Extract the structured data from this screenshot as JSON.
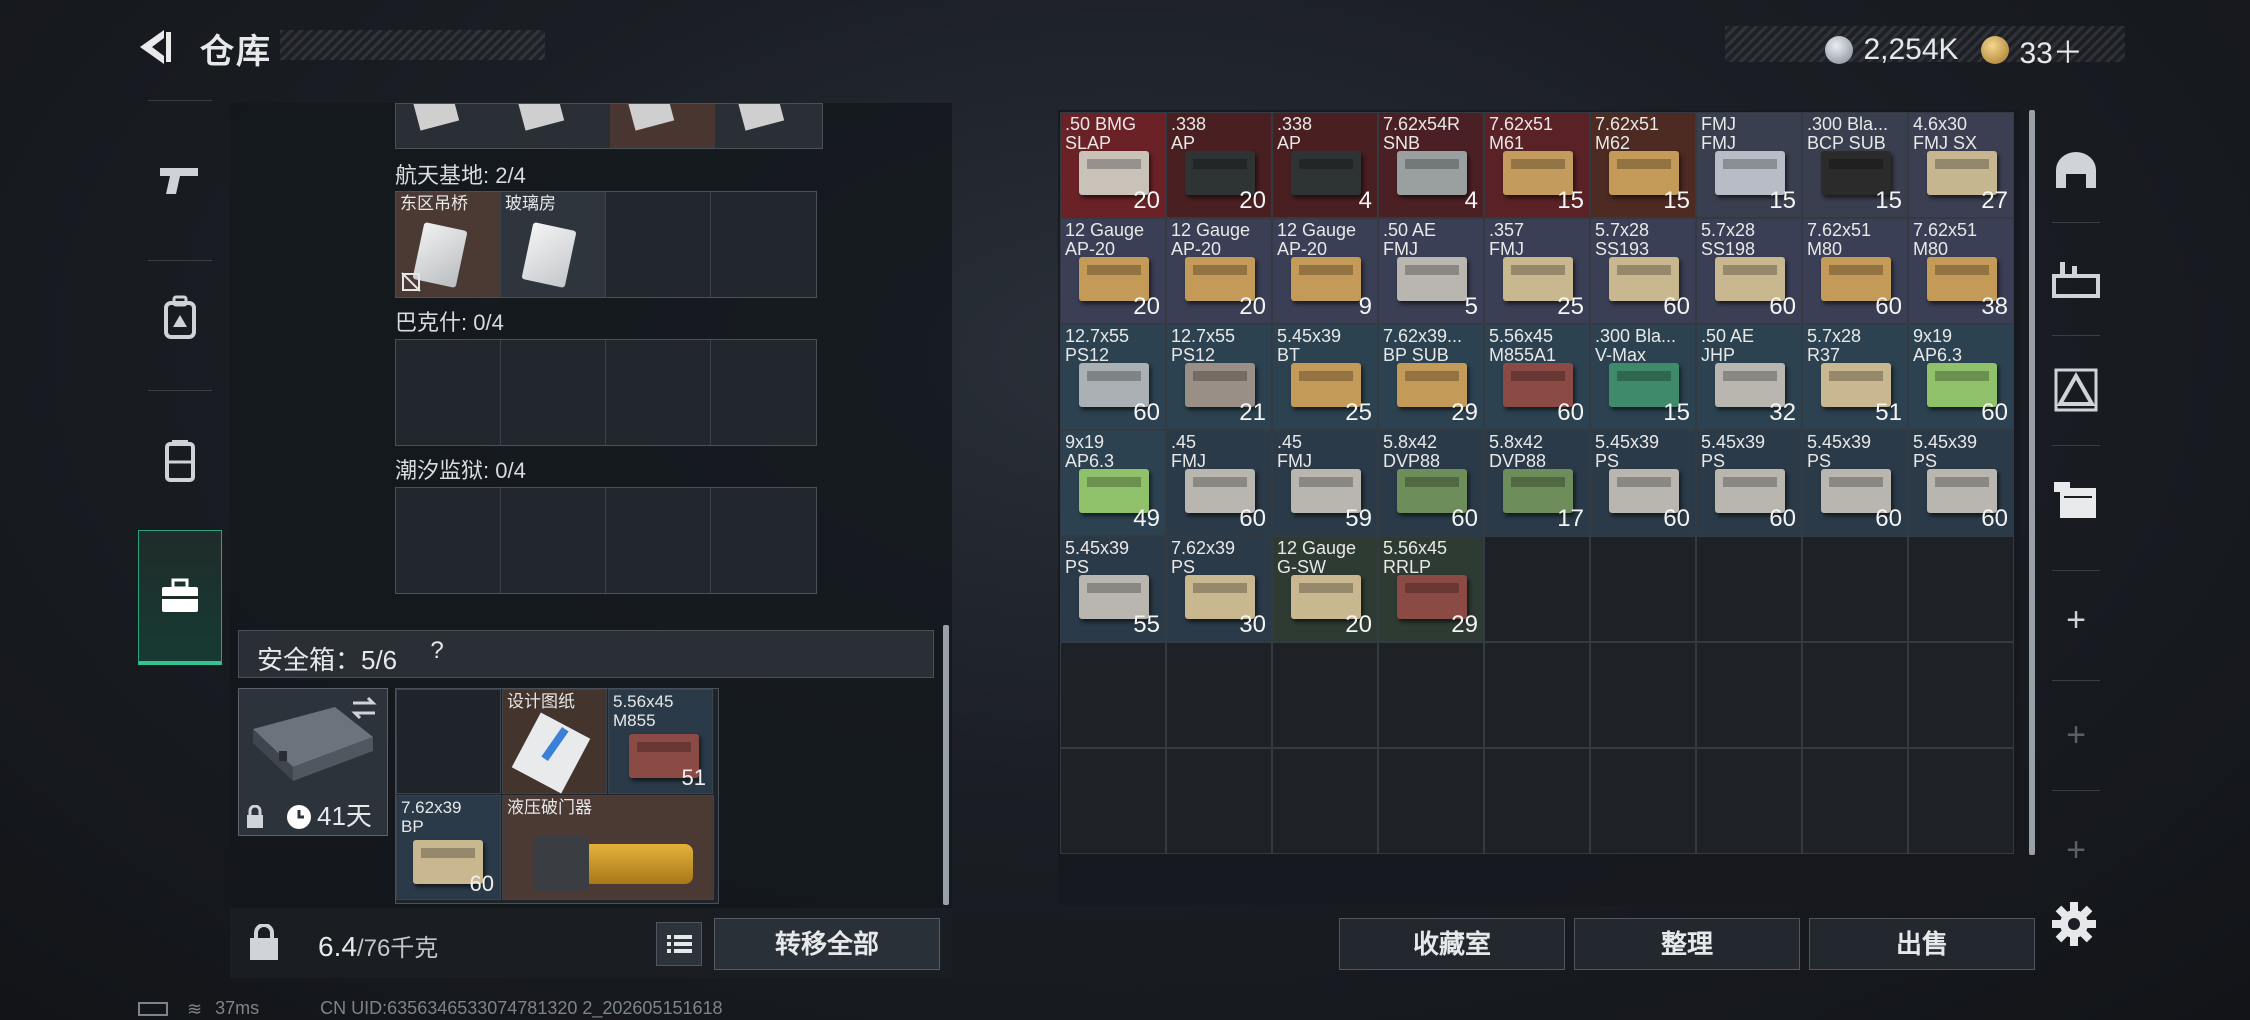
{
  "header": {
    "title": "仓库"
  },
  "currency": [
    {
      "icon": "silver-coin-icon",
      "value": "2,254K",
      "color": "#b9c0c8"
    },
    {
      "icon": "gold-coin-icon",
      "value": "33＋",
      "color": "#c9a043"
    }
  ],
  "left_nav": [
    {
      "icon": "pistol-icon"
    },
    {
      "icon": "backpack-icon"
    },
    {
      "icon": "vest-icon"
    },
    {
      "icon": "briefcase-icon",
      "active": true
    }
  ],
  "sections": [
    {
      "label": "航天基地: 2/4",
      "slots": [
        {
          "name": "东区吊桥",
          "locked": true
        },
        {
          "name": "玻璃房"
        },
        {
          "name": ""
        },
        {
          "name": ""
        }
      ]
    },
    {
      "label": "巴克什: 0/4"
    },
    {
      "label": "潮汐监狱: 0/4"
    }
  ],
  "safe_box": {
    "label": "安全箱：5/6",
    "help": "?",
    "timer": "41天",
    "items": [
      {
        "name": "设计图纸",
        "count": ""
      },
      {
        "name": "5.56x45\nM855",
        "count": "51"
      },
      {
        "name": "7.62x39\nBP",
        "count": "60"
      },
      {
        "name": "液压破门器",
        "count": ""
      }
    ]
  },
  "weight": {
    "current": "6.4",
    "max": "/76千克"
  },
  "buttons": {
    "transfer_all": "转移全部",
    "collection": "收藏室",
    "organize": "整理",
    "sell": "出售"
  },
  "stash_items": [
    {
      "name": ".50 BMG\nSLAP",
      "count": "20",
      "bg": "#6b2226",
      "box": "#c8c2b8"
    },
    {
      "name": ".338\nAP",
      "count": "20",
      "bg": "#4a1f22",
      "box": "#2e3334"
    },
    {
      "name": ".338\nAP",
      "count": "4",
      "bg": "#4a1f22",
      "box": "#2e3334"
    },
    {
      "name": "7.62x54R\nSNB",
      "count": "4",
      "bg": "#4b2024",
      "box": "#9aa0a0"
    },
    {
      "name": "7.62x51\nM61",
      "count": "15",
      "bg": "#5a2226",
      "box": "#c39b5c"
    },
    {
      "name": "7.62x51\nM62",
      "count": "15",
      "bg": "#4d2a22",
      "box": "#c49a58"
    },
    {
      "name": "FMJ\nFMJ",
      "count": "15",
      "bg": "#3a3f4f",
      "box": "#b7bcc6"
    },
    {
      "name": ".300 Bla...\nBCP SUB",
      "count": "15",
      "bg": "#3a3f4f",
      "box": "#2b2b2b"
    },
    {
      "name": "4.6x30\nFMJ SX",
      "count": "27",
      "bg": "#3c3f52",
      "box": "#c5b690"
    },
    {
      "name": "12 Gauge\nAP-20",
      "count": "20",
      "bg": "#3a3f55",
      "box": "#c49a58"
    },
    {
      "name": "12 Gauge\nAP-20",
      "count": "20",
      "bg": "#3a3f55",
      "box": "#c49a58"
    },
    {
      "name": "12 Gauge\nAP-20",
      "count": "9",
      "bg": "#3a3f55",
      "box": "#c49a58"
    },
    {
      "name": ".50 AE\nFMJ",
      "count": "5",
      "bg": "#3a3f55",
      "box": "#b8b6ae"
    },
    {
      "name": ".357\nFMJ",
      "count": "25",
      "bg": "#3a3f55",
      "box": "#c9b78f"
    },
    {
      "name": "5.7x28\nSS193",
      "count": "60",
      "bg": "#3a3f55",
      "box": "#c9b78f"
    },
    {
      "name": "5.7x28\nSS198",
      "count": "60",
      "bg": "#3a3f55",
      "box": "#c9b78f"
    },
    {
      "name": "7.62x51\nM80",
      "count": "60",
      "bg": "#3a3f55",
      "box": "#c49a58"
    },
    {
      "name": "7.62x51\nM80",
      "count": "38",
      "bg": "#3a3f55",
      "box": "#c49a58"
    },
    {
      "name": "12.7x55\nPS12",
      "count": "60",
      "bg": "#2c4250",
      "box": "#aab0b4"
    },
    {
      "name": "12.7x55\nPS12",
      "count": "21",
      "bg": "#2c4250",
      "box": "#9a8f86"
    },
    {
      "name": "5.45x39\nBT",
      "count": "25",
      "bg": "#2c4250",
      "box": "#c49a58"
    },
    {
      "name": "7.62x39...\nBP SUB",
      "count": "29",
      "bg": "#2c4250",
      "box": "#c49a58"
    },
    {
      "name": "5.56x45\nM855A1",
      "count": "60",
      "bg": "#2c4250",
      "box": "#8c4a44"
    },
    {
      "name": ".300 Bla...\nV-Max",
      "count": "15",
      "bg": "#2c4250",
      "box": "#3f8a6a"
    },
    {
      "name": ".50 AE\nJHP",
      "count": "32",
      "bg": "#2c4250",
      "box": "#b8b6ae"
    },
    {
      "name": "5.7x28\nR37",
      "count": "51",
      "bg": "#2c4250",
      "box": "#c9b78f"
    },
    {
      "name": "9x19\nAP6.3",
      "count": "60",
      "bg": "#2c4250",
      "box": "#8fc16a"
    },
    {
      "name": "9x19\nAP6.3",
      "count": "49",
      "bg": "#2c4250",
      "box": "#8fc16a"
    },
    {
      "name": ".45\nFMJ",
      "count": "60",
      "bg": "#2a3a48",
      "box": "#b8b6ae"
    },
    {
      "name": ".45\nFMJ",
      "count": "59",
      "bg": "#2a3a48",
      "box": "#b8b6ae"
    },
    {
      "name": "5.8x42\nDVP88",
      "count": "60",
      "bg": "#2a3a48",
      "box": "#6d8d5a"
    },
    {
      "name": "5.8x42\nDVP88",
      "count": "17",
      "bg": "#2a3a48",
      "box": "#6d8d5a"
    },
    {
      "name": "5.45x39\nPS",
      "count": "60",
      "bg": "#2a3a48",
      "box": "#b8b6ae"
    },
    {
      "name": "5.45x39\nPS",
      "count": "60",
      "bg": "#2a3a48",
      "box": "#b8b6ae"
    },
    {
      "name": "5.45x39\nPS",
      "count": "60",
      "bg": "#2a3a48",
      "box": "#b8b6ae"
    },
    {
      "name": "5.45x39\nPS",
      "count": "60",
      "bg": "#2a3a48",
      "box": "#b8b6ae"
    },
    {
      "name": "5.45x39\nPS",
      "count": "55",
      "bg": "#2a3a48",
      "box": "#b8b6ae"
    },
    {
      "name": "7.62x39\nPS",
      "count": "30",
      "bg": "#2a3a48",
      "box": "#c9b78f"
    },
    {
      "name": "12 Gauge\nG-SW",
      "count": "20",
      "bg": "#2e3b33",
      "box": "#c9b78f"
    },
    {
      "name": "5.56x45\nRRLP",
      "count": "29",
      "bg": "#2e3b33",
      "box": "#8c4a44"
    }
  ],
  "right_nav": [
    {
      "icon": "shield-icon"
    },
    {
      "icon": "crafting-icon"
    },
    {
      "icon": "hazard-icon"
    },
    {
      "icon": "folder-iv-icon"
    },
    {
      "icon": "plus-icon",
      "label": "+"
    },
    {
      "icon": "plus-icon",
      "label": "+"
    },
    {
      "icon": "plus-icon",
      "label": "+"
    },
    {
      "icon": "gear-icon"
    }
  ],
  "status": {
    "ping": "37ms",
    "uid": "CN UID:6356346533074781320 2_202605151618"
  }
}
